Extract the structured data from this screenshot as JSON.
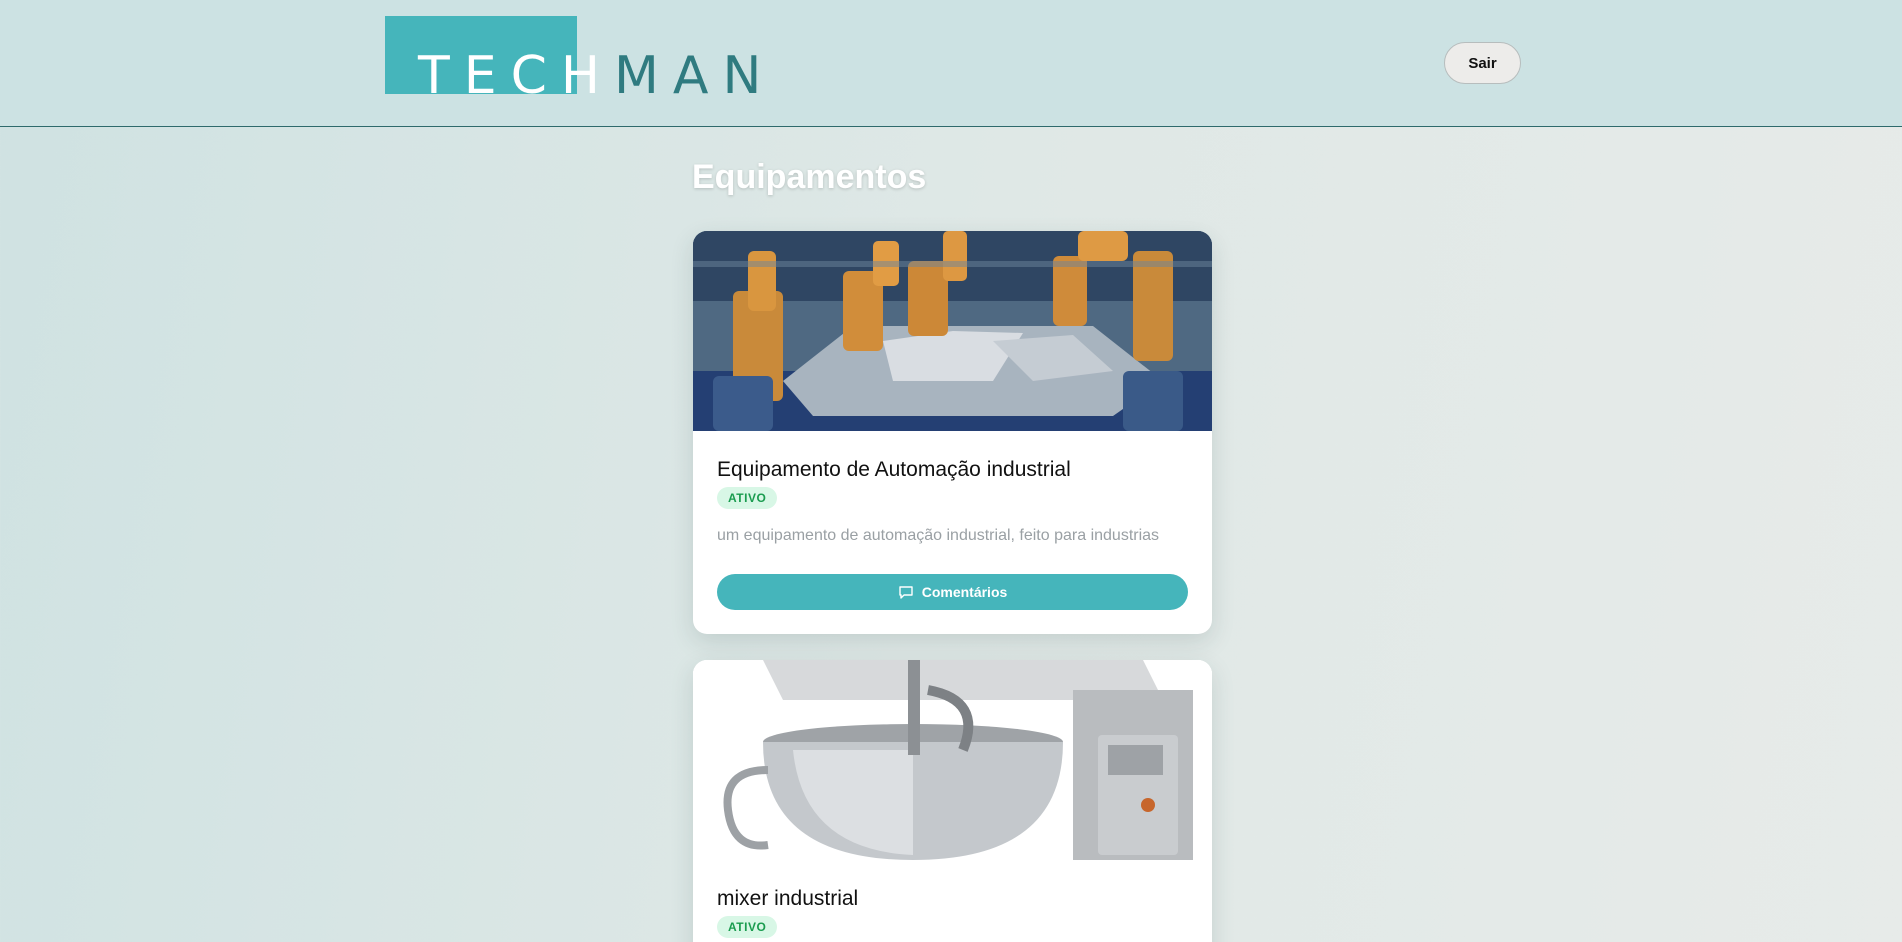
{
  "header": {
    "logo": {
      "part1": "TECH",
      "part2": "MAN"
    },
    "logout_label": "Sair"
  },
  "main": {
    "title": "Equipamentos",
    "equipment": [
      {
        "name": "Equipamento de Automação industrial",
        "status": "ATIVO",
        "description": "um equipamento de automação industrial, feito para industrias",
        "comments_label": "Comentários",
        "image_icon": "industrial-robots-photo"
      },
      {
        "name": "mixer industrial",
        "status": "ATIVO",
        "image_icon": "industrial-mixer-photo"
      }
    ]
  },
  "colors": {
    "accent": "#45b5bb",
    "header_bg": "#cce2e3",
    "status_bg": "#d8f7e6",
    "status_text": "#1a9c4f"
  }
}
